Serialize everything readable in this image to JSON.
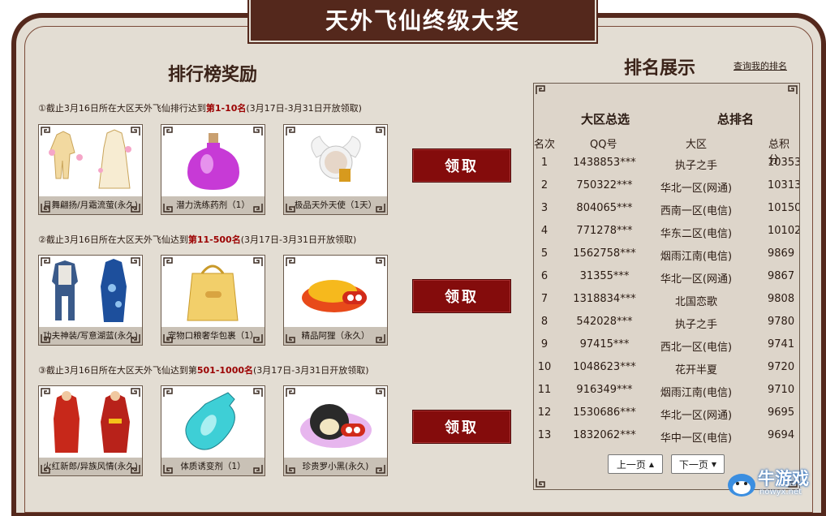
{
  "header": {
    "title": "天外飞仙终级大奖"
  },
  "rewards": {
    "title": "排行榜奖励",
    "tiers": [
      {
        "cond_prefix": "①截止3月16日所在大区天外飞仙排行达到",
        "cond_rank": "第1-10名",
        "cond_suffix": "(3月17日-3月31日开放领取)",
        "items": [
          "月舞翩扬/月霜流萤(永久)",
          "潜力洗练药剂（1）",
          "极品天外天使（1天）"
        ],
        "button": "领取"
      },
      {
        "cond_prefix": "②截止3月16日所在大区天外飞仙达到",
        "cond_rank": "第11-500名",
        "cond_suffix": "(3月17日-3月31日开放领取)",
        "items": [
          "功夫神装/写意湖蓝(永久)",
          "宠物口粮奢华包裹（1）",
          "精品阿狸（永久）"
        ],
        "button": "领取"
      },
      {
        "cond_prefix": "③截止3月16日所在大区天外飞仙达到第",
        "cond_rank": "501-1000名",
        "cond_suffix": "(3月17日-3月31日开放领取)",
        "items": [
          "火红新郎/异族风情(永久)",
          "体质诱变剂（1）",
          "珍贵罗小黑(永久)"
        ],
        "button": "领取"
      }
    ]
  },
  "ranking": {
    "title": "排名展示",
    "my_rank_link": "查询我的排名",
    "header_left": "大区总选",
    "header_right": "总排名",
    "columns": [
      "名次",
      "QQ号",
      "大区",
      "总积分"
    ],
    "rows": [
      {
        "rank": "1",
        "qq": "1438853***",
        "area": "执子之手",
        "score": "10353"
      },
      {
        "rank": "2",
        "qq": "750322***",
        "area": "华北一区(网通)",
        "score": "10313"
      },
      {
        "rank": "3",
        "qq": "804065***",
        "area": "西南一区(电信)",
        "score": "10150"
      },
      {
        "rank": "4",
        "qq": "771278***",
        "area": "华东二区(电信)",
        "score": "10102"
      },
      {
        "rank": "5",
        "qq": "1562758***",
        "area": "烟雨江南(电信)",
        "score": "9869"
      },
      {
        "rank": "6",
        "qq": "31355***",
        "area": "华北一区(网通)",
        "score": "9867"
      },
      {
        "rank": "7",
        "qq": "1318834***",
        "area": "北国恋歌",
        "score": "9808"
      },
      {
        "rank": "8",
        "qq": "542028***",
        "area": "执子之手",
        "score": "9780"
      },
      {
        "rank": "9",
        "qq": "97415***",
        "area": "西北一区(电信)",
        "score": "9741"
      },
      {
        "rank": "10",
        "qq": "1048623***",
        "area": "花开半夏",
        "score": "9720"
      },
      {
        "rank": "11",
        "qq": "916349***",
        "area": "烟雨江南(电信)",
        "score": "9710"
      },
      {
        "rank": "12",
        "qq": "1530686***",
        "area": "华北一区(网通)",
        "score": "9695"
      },
      {
        "rank": "13",
        "qq": "1832062***",
        "area": "华中一区(电信)",
        "score": "9694"
      }
    ],
    "prev_label": "上一页",
    "next_label": "下一页"
  },
  "watermark": {
    "name": "牛游戏",
    "url": "nowyx.net"
  }
}
